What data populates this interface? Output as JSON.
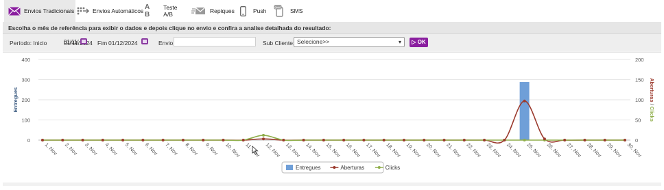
{
  "tabs": [
    {
      "label": "Envios Tradicionais",
      "icon": "envelope-icon",
      "active": true
    },
    {
      "label": "Envios Automáticos",
      "icon": "automation-icon",
      "active": false
    },
    {
      "label": "Teste A/B",
      "icon": "ab-test-icon",
      "active": false
    },
    {
      "label": "Repiques",
      "icon": "resend-icon",
      "active": false
    },
    {
      "label": "Push",
      "icon": "phone-icon",
      "active": false
    },
    {
      "label": "SMS",
      "icon": "sms-icon",
      "active": false
    }
  ],
  "instruction": "Escolha o mês de referência para exibir o dados e depois clique no envio e confira a analise detalhada do resultado:",
  "filters": {
    "periodo_label": "Período: Inicio",
    "inicio_value": "01/11/2024",
    "fim_label": "Fim",
    "fim_value": "01/12/2024",
    "envio_label": "Envio",
    "envio_value": "",
    "subcliente_label": "Sub Cliente:",
    "subcliente_value": "Selecione>>",
    "ok_label": "OK"
  },
  "colors": {
    "accent": "#8a1e9f",
    "entregues": "#6f9fd8",
    "aberturas": "#9b3a2d",
    "clicks": "#8fae4b"
  },
  "chart_data": {
    "type": "bar",
    "categories": [
      "1. Nov",
      "2. Nov",
      "3. Nov",
      "4. Nov",
      "5. Nov",
      "6. Nov",
      "7. Nov",
      "8. Nov",
      "9. Nov",
      "10. Nov",
      "11. Nov",
      "12. Nov",
      "13. Nov",
      "14. Nov",
      "15. Nov",
      "16. Nov",
      "17. Nov",
      "18. Nov",
      "19. Nov",
      "20. Nov",
      "21. Nov",
      "22. Nov",
      "23. Nov",
      "24. Nov",
      "25. Nov",
      "26. Nov",
      "27. Nov",
      "28. Nov",
      "29. Nov",
      "30. Nov"
    ],
    "series": [
      {
        "name": "Entregues",
        "type": "bar",
        "axis": "left",
        "values": [
          0,
          0,
          0,
          0,
          0,
          0,
          0,
          0,
          0,
          0,
          0,
          0,
          0,
          0,
          0,
          0,
          0,
          0,
          0,
          0,
          0,
          0,
          0,
          0,
          288,
          0,
          0,
          0,
          0,
          0
        ]
      },
      {
        "name": "Aberturas",
        "type": "spline",
        "axis": "right",
        "values": [
          0,
          0,
          0,
          0,
          0,
          0,
          0,
          0,
          0,
          0,
          0,
          3,
          0,
          0,
          0,
          0,
          0,
          0,
          0,
          0,
          0,
          0,
          0,
          0,
          97,
          3,
          0,
          0,
          0,
          0
        ]
      },
      {
        "name": "Clicks",
        "type": "spline",
        "axis": "right",
        "values": [
          0,
          0,
          0,
          0,
          0,
          0,
          0,
          0,
          0,
          0,
          0,
          12,
          0,
          0,
          0,
          0,
          0,
          0,
          0,
          0,
          0,
          0,
          0,
          0,
          0,
          0,
          0,
          0,
          0,
          0
        ]
      }
    ],
    "ylabel": "Entregues",
    "y2label": "Aberturas / Clicks",
    "ylim": [
      0,
      400
    ],
    "yticks": [
      0,
      100,
      200,
      300,
      400
    ],
    "y2lim": [
      0,
      200
    ],
    "y2ticks": [
      0,
      50,
      100,
      150,
      200
    ],
    "legend": "bottom-center"
  }
}
